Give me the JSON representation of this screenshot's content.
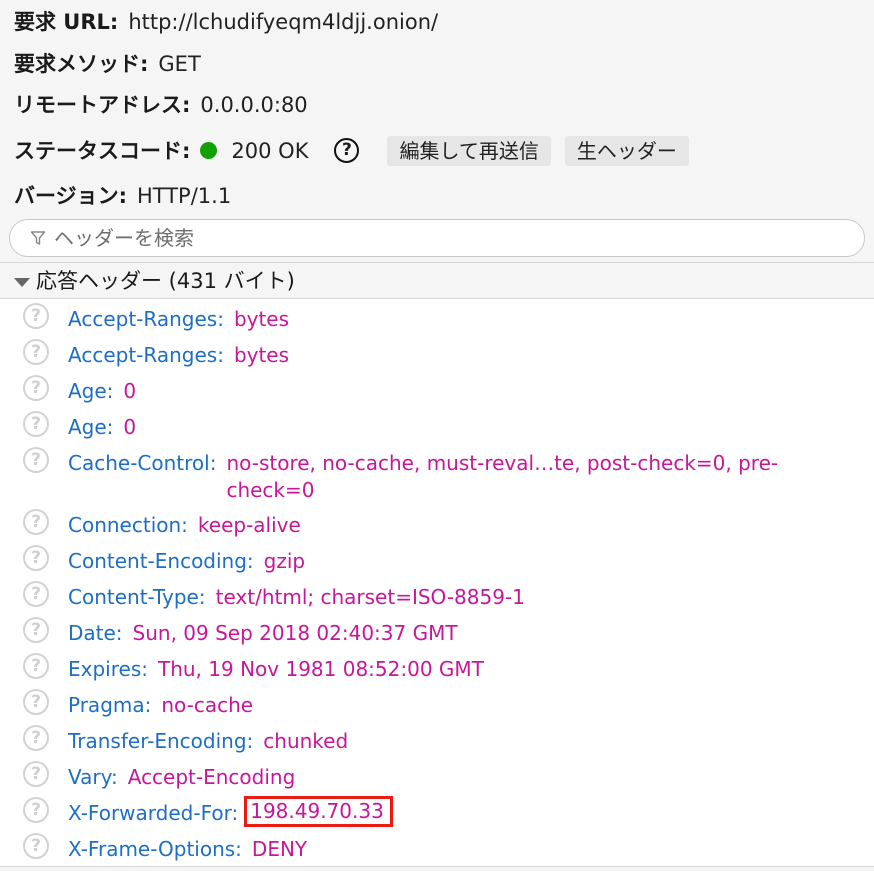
{
  "summary": {
    "request_url": {
      "label": "要求 URL:",
      "value": "http://lchudifyeqm4ldjj.onion/"
    },
    "request_method": {
      "label": "要求メソッド:",
      "value": "GET"
    },
    "remote_address": {
      "label": "リモートアドレス:",
      "value": "0.0.0.0:80"
    },
    "status_code": {
      "label": "ステータスコード:",
      "value": "200 OK",
      "status_color": "#11a100"
    },
    "version": {
      "label": "バージョン:",
      "value": "HTTP/1.1"
    }
  },
  "toolbar": {
    "help_glyph": "?",
    "edit_resend_label": "編集して再送信",
    "raw_headers_label": "生ヘッダー"
  },
  "filter": {
    "placeholder": "ヘッダーを検索",
    "icon": "filter-icon"
  },
  "response_headers": {
    "title": "応答ヘッダー (431 バイト)",
    "help_glyph": "?",
    "rows": [
      {
        "name": "Accept-Ranges:",
        "value": "bytes"
      },
      {
        "name": "Accept-Ranges:",
        "value": "bytes"
      },
      {
        "name": "Age:",
        "value": "0"
      },
      {
        "name": "Age:",
        "value": "0"
      },
      {
        "name": "Cache-Control:",
        "value": "no-store, no-cache, must-reval…te, post-check=0, pre-check=0"
      },
      {
        "name": "Connection:",
        "value": "keep-alive"
      },
      {
        "name": "Content-Encoding:",
        "value": "gzip"
      },
      {
        "name": "Content-Type:",
        "value": "text/html; charset=ISO-8859-1"
      },
      {
        "name": "Date:",
        "value": "Sun, 09 Sep 2018 02:40:37 GMT"
      },
      {
        "name": "Expires:",
        "value": "Thu, 19 Nov 1981 08:52:00 GMT"
      },
      {
        "name": "Pragma:",
        "value": "no-cache"
      },
      {
        "name": "Transfer-Encoding:",
        "value": "chunked"
      },
      {
        "name": "Vary:",
        "value": "Accept-Encoding"
      },
      {
        "name": "X-Forwarded-For:",
        "value": "198.49.70.33",
        "highlight_color": "#ea1c12"
      },
      {
        "name": "X-Frame-Options:",
        "value": "DENY"
      }
    ]
  }
}
